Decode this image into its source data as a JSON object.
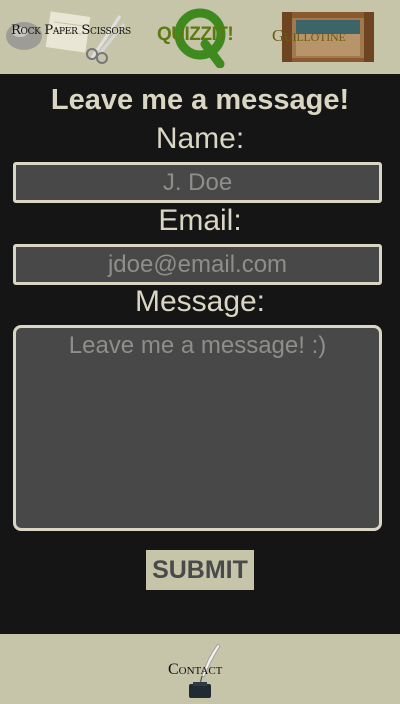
{
  "nav": {
    "items": [
      {
        "label": "Rock Paper Scissors"
      },
      {
        "label": "QUIZZIT!"
      },
      {
        "label": "Guillotine"
      }
    ]
  },
  "form": {
    "title": "Leave me a message!",
    "name_label": "Name:",
    "name_placeholder": "J. Doe",
    "email_label": "Email:",
    "email_placeholder": "jdoe@email.com",
    "message_label": "Message:",
    "message_placeholder": "Leave me a message! :)",
    "submit_label": "SUBMIT"
  },
  "footer": {
    "contact_label": "Contact"
  },
  "colors": {
    "page_background": "#151515",
    "bar_background": "#c6c5a9",
    "text": "#d9d7c3",
    "field_background": "#484848"
  }
}
